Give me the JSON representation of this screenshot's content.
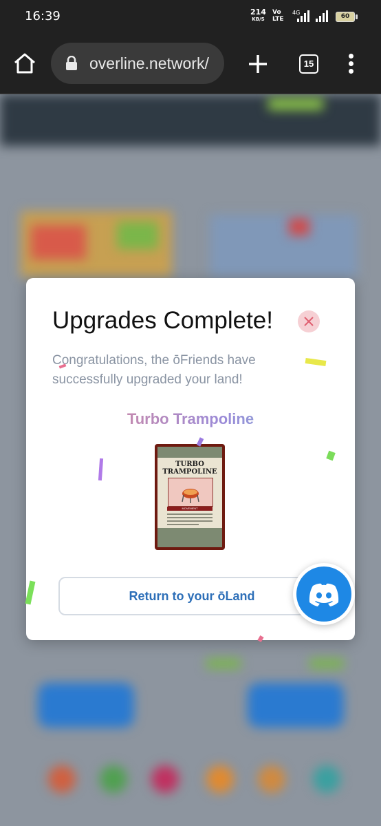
{
  "statusbar": {
    "time": "16:39",
    "net_speed_value": "214",
    "net_speed_unit": "KB/S",
    "volte_top": "Vo",
    "volte_bottom": "LTE",
    "network_type": "4G",
    "battery": "60"
  },
  "browser": {
    "url": "overline.network/",
    "tab_count": "15"
  },
  "modal": {
    "title": "Upgrades Complete!",
    "message": "Congratulations, the ōFriends have successfully upgraded your land!",
    "item_name": "Turbo Trampoline",
    "card": {
      "title_line1": "TURBO",
      "title_line2": "TRAMPOLINE",
      "ribbon": "MOVEMENT"
    },
    "return_button": "Return to your ōLand"
  },
  "colors": {
    "accent": "#2d6fb8",
    "discord": "#1e88e5",
    "close_bg": "#f6d0d4",
    "close_x": "#e06070"
  }
}
